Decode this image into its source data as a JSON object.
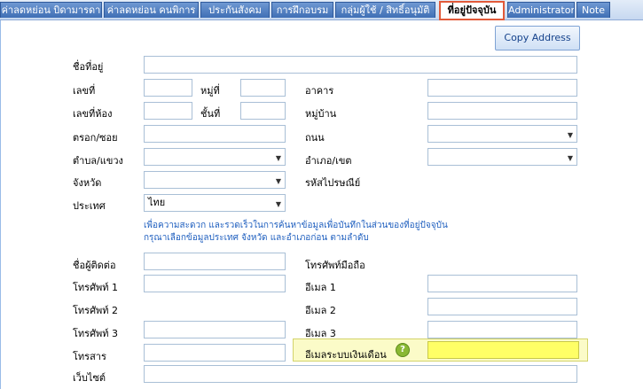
{
  "tabs": [
    {
      "label": "ค่าลดหย่อน บิดามารดา"
    },
    {
      "label": "ค่าลดหย่อน คนพิการ"
    },
    {
      "label": "ประกันสังคม"
    },
    {
      "label": "การฝึกอบรม"
    },
    {
      "label": "กลุ่มผู้ใช้ / สิทธิ์อนุมัติ"
    },
    {
      "label": "ที่อยู่ปัจจุบัน"
    },
    {
      "label": "Administrator"
    },
    {
      "label": "Note"
    }
  ],
  "copy_button": "Copy Address",
  "form": {
    "address_name": "ชื่อที่อยู่",
    "house_no": "เลขที่",
    "moo": "หมู่ที่",
    "building": "อาคาร",
    "room_no": "เลขที่ห้อง",
    "floor": "ชั้นที่",
    "village": "หมู่บ้าน",
    "soi": "ตรอก/ซอย",
    "road": "ถนน",
    "subdistrict": "ตำบล/แขวง",
    "district": "อำเภอ/เขต",
    "province": "จังหวัด",
    "postcode": "รหัสไปรษณีย์",
    "country": "ประเทศ",
    "country_value": "ไทย",
    "note": "เพื่อความสะดวก และรวดเร็วในการค้นหาข้อมูลเพื่อบันทึกในส่วนของที่อยู่ปัจจุบัน กรุณาเลือกข้อมูลประเทศ จังหวัด และอำเภอก่อน ตามลำดับ",
    "contact_name": "ชื่อผู้ติดต่อ",
    "mobile": "โทรศัพท์มือถือ",
    "phone1": "โทรศัพท์ 1",
    "email1": "อีเมล 1",
    "phone2": "โทรศัพท์ 2",
    "email2": "อีเมล 2",
    "phone3": "โทรศัพท์ 3",
    "email3": "อีเมล 3",
    "fax": "โทรสาร",
    "salary_email": "อีเมลระบบเงินเดือน",
    "help": "?",
    "website": "เว็บไซต์"
  },
  "colors": {
    "active_tab_border": "#e25a3a",
    "highlight": "#ffff66",
    "note_text": "#1f5fbf"
  }
}
